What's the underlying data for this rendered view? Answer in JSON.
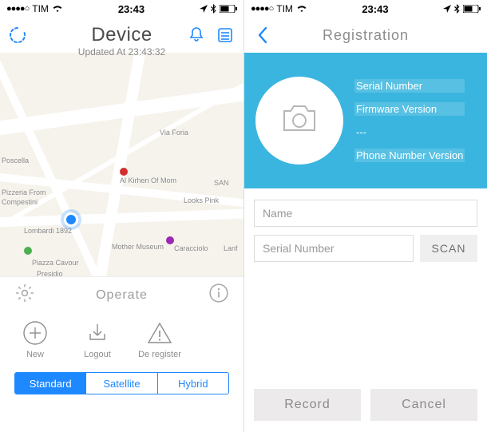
{
  "status": {
    "carrier": "TIM",
    "time": "23:43",
    "signal_dots": "●●●●○"
  },
  "left": {
    "title": "Device",
    "subtitle": "Updated At 23:43:32",
    "map": {
      "labels": {
        "via_foria": "Via Foria",
        "kirhen": "Al Kirhen Of Mom",
        "looks": "Looks Pink",
        "lombardi": "Lombardi 1892",
        "mother": "Mother Museum",
        "caracciolo": "Caracciolo",
        "piazza": "Piazza Cavour",
        "presidio": "Presidio",
        "san": "SAN",
        "lanf": "Lanf",
        "pizzeria": "Pizzeria From",
        "poscella": "Poscella",
        "compestini": "Compestini"
      }
    },
    "operate_label": "Operate",
    "actions": {
      "new": "New",
      "logout": "Logout",
      "deregister": "De register"
    },
    "seg": {
      "standard": "Standard",
      "satellite": "Satellite",
      "hybrid": "Hybrid"
    }
  },
  "right": {
    "title": "Registration",
    "header": {
      "serial": "Serial Number",
      "firmware": "Firmware Version",
      "dashes": "---",
      "phone": "Phone Number Version"
    },
    "form": {
      "name_placeholder": "Name",
      "serial_placeholder": "Serial Number",
      "scan": "SCAN"
    },
    "buttons": {
      "record": "Record",
      "cancel": "Cancel"
    }
  }
}
